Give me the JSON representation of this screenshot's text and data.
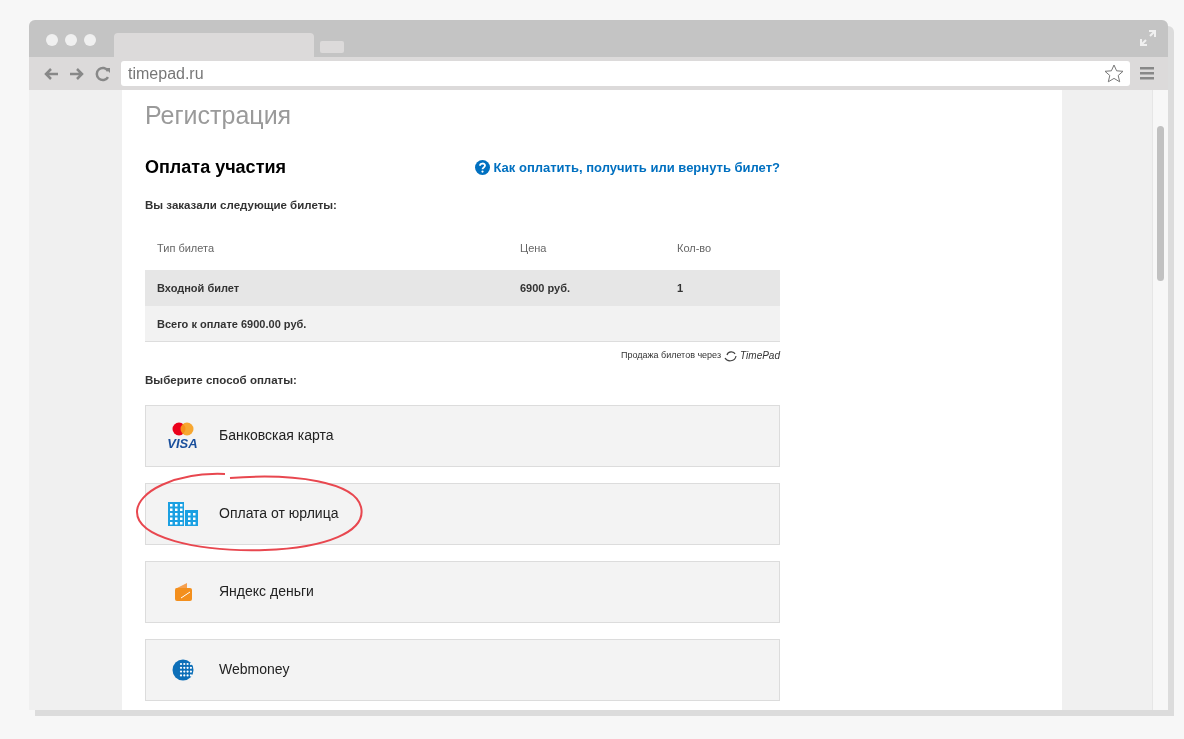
{
  "browser": {
    "url": "timepad.ru"
  },
  "page": {
    "title": "Регистрация",
    "section_title": "Оплата участия",
    "help_link": "Как оплатить, получить или вернуть билет?",
    "order_caption": "Вы заказали следующие билеты:",
    "table": {
      "columns": [
        "Тип билета",
        "Цена",
        "Кол-во"
      ],
      "rows": [
        [
          "Входной билет",
          "6900 руб."
        ]
      ],
      "row_quantity": "1",
      "total": "Всего к оплате 6900.00 руб."
    },
    "powered_by": {
      "text": "Продажа билетов через",
      "logo_text": "TimePad"
    },
    "methods_caption": "Выберите способ оплаты:",
    "methods": [
      {
        "kind": "card",
        "label": "Банковская карта",
        "logo_text": "VISA",
        "highlighted": false
      },
      {
        "kind": "company",
        "label": "Оплата от юрлица",
        "highlighted": true
      },
      {
        "kind": "yandex",
        "label": "Яндекс деньги",
        "highlighted": false
      },
      {
        "kind": "webmoney",
        "label": "Webmoney",
        "highlighted": false
      }
    ]
  }
}
